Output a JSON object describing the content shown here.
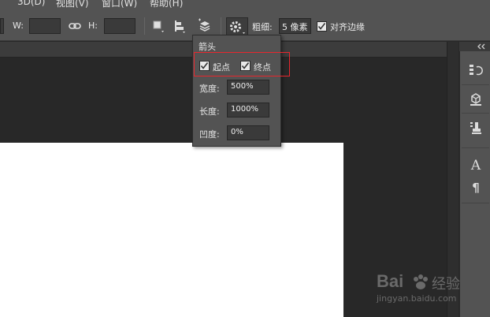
{
  "menu": {
    "items": [
      "3D(D)",
      "视图(V)",
      "窗口(W)",
      "帮助(H)"
    ]
  },
  "options": {
    "width_label": "W:",
    "width_value": "",
    "height_label": "H:",
    "height_value": "",
    "weight_label": "粗细:",
    "weight_value": "5 像素",
    "align_edges_label": "对齐边缘",
    "align_edges_checked": true
  },
  "arrow_popup": {
    "title": "箭头",
    "start_label": "起点",
    "start_checked": true,
    "end_label": "终点",
    "end_checked": true,
    "width_label": "宽度:",
    "width_value": "500%",
    "length_label": "长度:",
    "length_value": "1000%",
    "concavity_label": "凹度:",
    "concavity_value": "0%"
  },
  "panel": {
    "type_label": "A",
    "paragraph_label": "¶"
  },
  "watermark": {
    "brand": "Bai",
    "brand_cn": "经验",
    "url": "jingyan.baidu.com"
  },
  "colors": {
    "highlight": "#e8262d",
    "ui_bg": "#535353",
    "canvas_bg": "#282828"
  }
}
